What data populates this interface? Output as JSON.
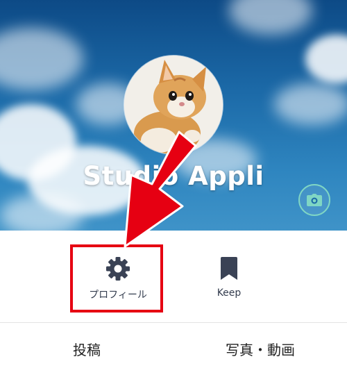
{
  "profile": {
    "name": "Studio Appli"
  },
  "actions": {
    "profile_label": "プロフィール",
    "keep_label": "Keep"
  },
  "tabs": {
    "posts_label": "投稿",
    "media_label": "写真・動画"
  },
  "colors": {
    "annotation_red": "#e60012",
    "icon_dark": "#3a4255",
    "camera_ring": "#7fd6c4"
  },
  "icons": {
    "settings": "gear-icon",
    "keep": "bookmark-icon",
    "camera": "camera-icon"
  }
}
